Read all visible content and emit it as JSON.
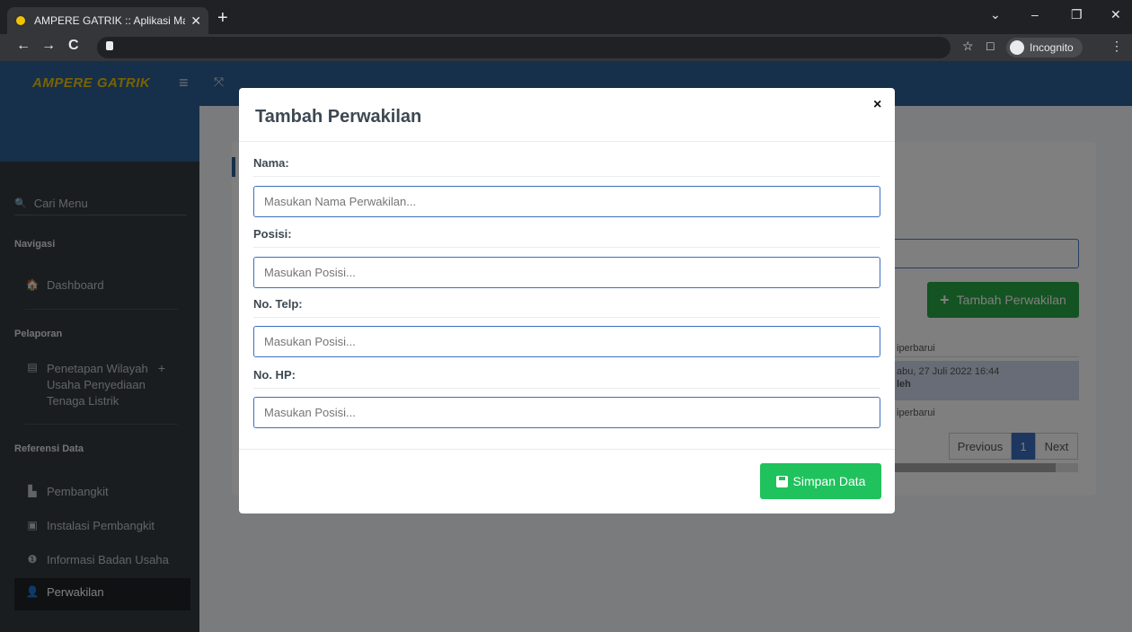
{
  "browser": {
    "tab_title": "AMPERE GATRIK :: Aplikasi Mana",
    "tab_close": "✕",
    "new_tab": "+",
    "back": "←",
    "forward": "→",
    "reload": "C",
    "star": "☆",
    "split": "□",
    "incognito_label": "Incognito",
    "menu": "⋮",
    "minimize": "–",
    "restore": "❐",
    "close": "✕",
    "chevron": "⌄"
  },
  "app": {
    "brand": "AMPERE GATRIK",
    "menu_toggle": "≡",
    "expand": "⤧"
  },
  "sidebar": {
    "search_icon": "🔍",
    "search_label": "Cari Menu",
    "sections": {
      "navigasi": "Navigasi",
      "pelaporan": "Pelaporan",
      "referensi": "Referensi Data"
    },
    "items": {
      "dashboard": {
        "icon": "🏠",
        "label": "Dashboard"
      },
      "penetapan": {
        "icon": "▤",
        "label": "Penetapan Wilayah Usaha Penyediaan Tenaga Listrik",
        "expand": "+"
      },
      "pembangkit": {
        "icon": "▙",
        "label": "Pembangkit"
      },
      "instalasi": {
        "icon": "▣",
        "label": "Instalasi Pembangkit"
      },
      "informasi": {
        "icon": "❶",
        "label": "Informasi Badan Usaha"
      },
      "perwakilan": {
        "icon": "👤",
        "label": "Perwakilan"
      }
    }
  },
  "background": {
    "add_button_icon": "+",
    "add_button": "Tambah Perwakilan",
    "rows": {
      "r1": "iperbarui",
      "r2a": "abu, 27 Juli 2022 16:44",
      "r2b": "leh",
      "r3": "iperbarui"
    },
    "pager": {
      "previous": "Previous",
      "page": "1",
      "next": "Next"
    }
  },
  "modal": {
    "title": "Tambah Perwakilan",
    "close": "×",
    "fields": {
      "nama": {
        "label": "Nama:",
        "placeholder": "Masukan Nama Perwakilan..."
      },
      "posisi": {
        "label": "Posisi:",
        "placeholder": "Masukan Posisi..."
      },
      "telp": {
        "label": "No. Telp:",
        "placeholder": "Masukan Posisi..."
      },
      "hp": {
        "label": "No. HP:",
        "placeholder": "Masukan Posisi..."
      }
    },
    "save_button": "Simpan Data"
  },
  "colors": {
    "brand_yellow": "#f0c400",
    "header_blue": "#2d5f94",
    "save_green": "#1fc25c",
    "add_green": "#28a745"
  }
}
